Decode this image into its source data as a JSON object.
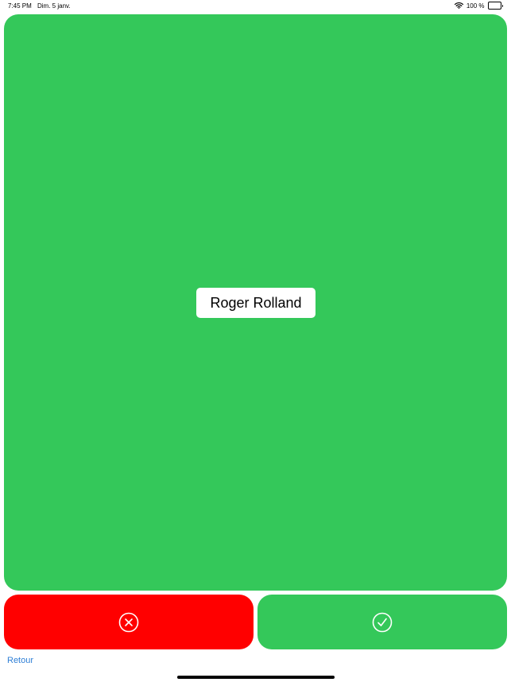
{
  "status_bar": {
    "time": "7:45 PM",
    "date": "Dim. 5 janv.",
    "battery_text": "100 %",
    "wifi_icon": "wifi-icon",
    "battery_icon": "battery-icon"
  },
  "card": {
    "name": "Roger Rolland",
    "color": "#34c85a"
  },
  "actions": {
    "reject": {
      "icon": "x-circle-icon",
      "color": "#ff0000"
    },
    "accept": {
      "icon": "checkmark-circle-icon",
      "color": "#34c85a"
    }
  },
  "navigation": {
    "back_label": "Retour",
    "link_color": "#2f7fd6"
  }
}
